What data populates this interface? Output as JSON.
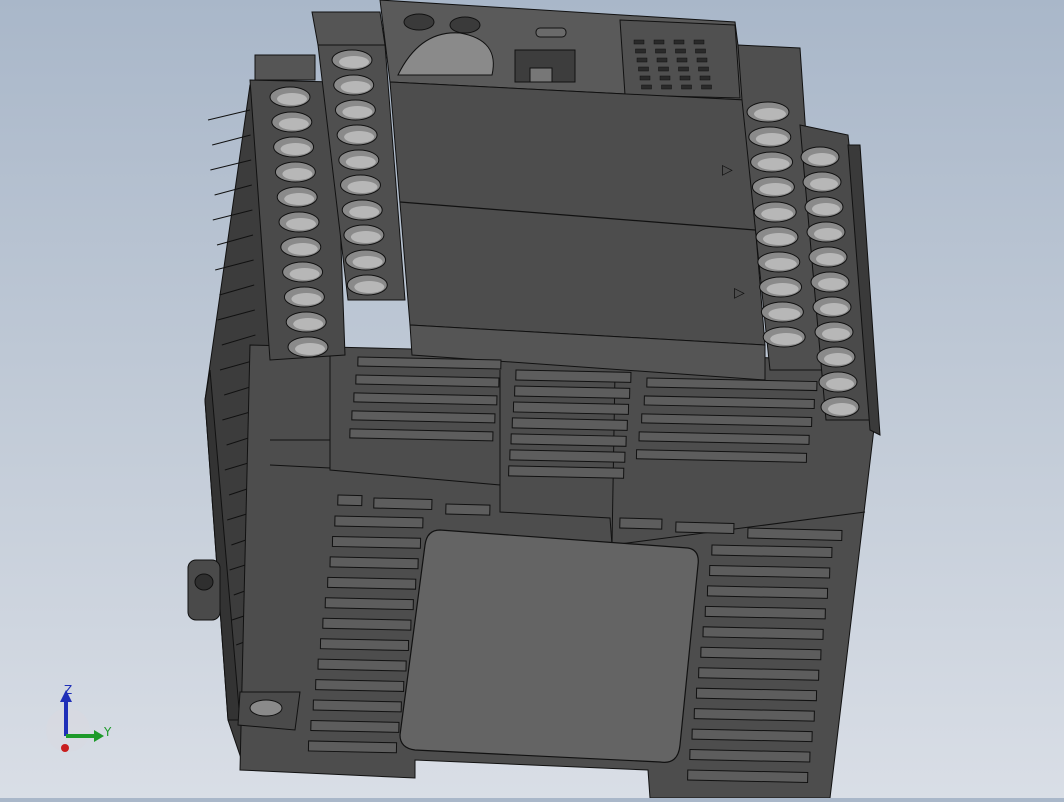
{
  "viewport": {
    "background_top": "#a9b7c9",
    "background_bottom": "#d9dee6",
    "model_colors": {
      "body": "#4a4a4a",
      "body_light": "#5c5c5c",
      "body_dark": "#353535",
      "face_top": "#616161",
      "edge": "#111111",
      "hole": "#8a8a8a",
      "hole_inner": "#b7b7b7"
    },
    "marker_symbols": [
      "▷",
      "▷"
    ]
  },
  "triad": {
    "z_label": "Z",
    "y_label": "Y",
    "z_color": "#1f2fb8",
    "y_color": "#1d9a2a",
    "x_color": "#c81e1e"
  }
}
